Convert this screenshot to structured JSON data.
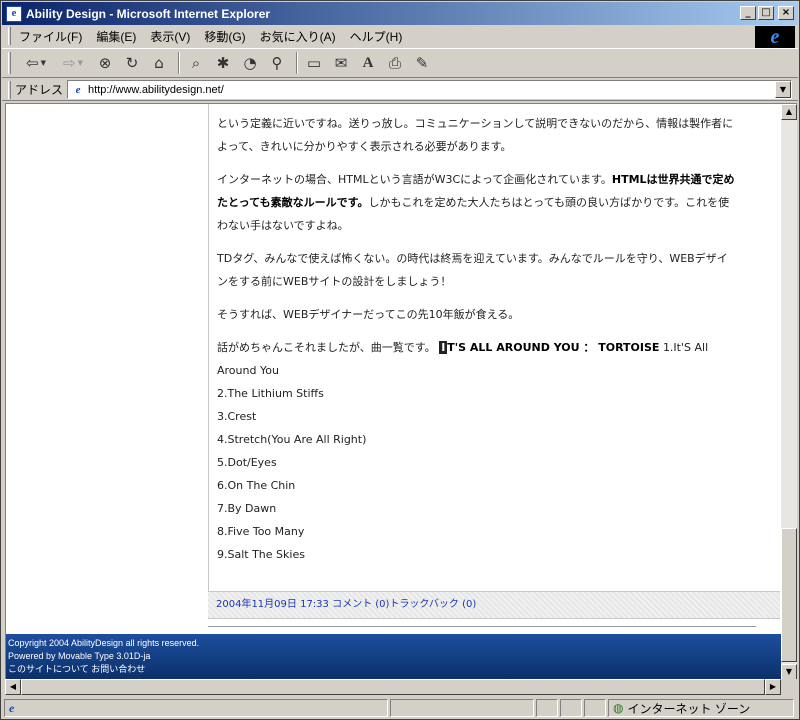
{
  "window": {
    "title": "Ability Design - Microsoft Internet Explorer",
    "minimize": "_",
    "maximize": "□",
    "close": "×",
    "app_icon": "e"
  },
  "menu": {
    "items": [
      "ファイル(F)",
      "編集(E)",
      "表示(V)",
      "移動(G)",
      "お気に入り(A)",
      "ヘルプ(H)"
    ],
    "logo": "e"
  },
  "toolbar": {
    "icons": [
      "back-arrow-icon",
      "forward-arrow-icon",
      "stop-icon",
      "refresh-icon",
      "home-icon",
      "search-icon",
      "favorites-icon",
      "history-icon",
      "channels-icon",
      "fullscreen-icon",
      "mail-icon",
      "font-icon",
      "print-icon",
      "edit-icon"
    ]
  },
  "address": {
    "label": "アドレス",
    "url": "http://www.abilitydesign.net/"
  },
  "article": {
    "p1": "という定義に近いですね。送りっ放し。コミュニケーションして説明できないのだから、情報は製作者によって、きれいに分かりやすく表示される必要があります。",
    "p2_pre": "インターネットの場合、HTMLという言語がW3Cによって企画化されています。",
    "p2_bold": "HTMLは世界共通で定めたとっても素敵なルールです。",
    "p2_post": "しかもこれを定めた大人たちはとっても頭の良い方ばかりです。これを使わない手はないですよね。",
    "p3": "TDタグ、みんなで使えば怖くない。の時代は終焉を迎えています。みんなでルールを守り、WEBデザインをする前にWEBサイトの設計をしましょう！",
    "p4": "そうすれば、WEBデザイナーだってこの先10年飯が食える。",
    "p5_pre": "話がめちゃんこそれましたが、曲一覧です。",
    "p5_album_first": "I",
    "p5_album_rest": "T'S ALL AROUND YOU ： TORTOISE",
    "tracks": [
      "1.It'S All Around You",
      "2.The Lithium Stiffs",
      "3.Crest",
      "4.Stretch(You Are All Right)",
      "5.Dot/Eyes",
      "6.On The Chin",
      "7.By Dawn",
      "8.Five Too Many",
      "9.Salt The Skies"
    ]
  },
  "meta": {
    "datetime": "2004年11月09日 17:33",
    "comments": "コメント (0)",
    "trackback": "トラックバック (0)"
  },
  "footer": {
    "copyright": "Copyright 2004 AbilityDesign all rights reserved.",
    "powered": "Powered by Movable Type 3.01D-ja",
    "about_link": "このサイトについて",
    "contact_link": "お問い合わせ"
  },
  "status": {
    "zone": "インターネット ゾーン"
  }
}
